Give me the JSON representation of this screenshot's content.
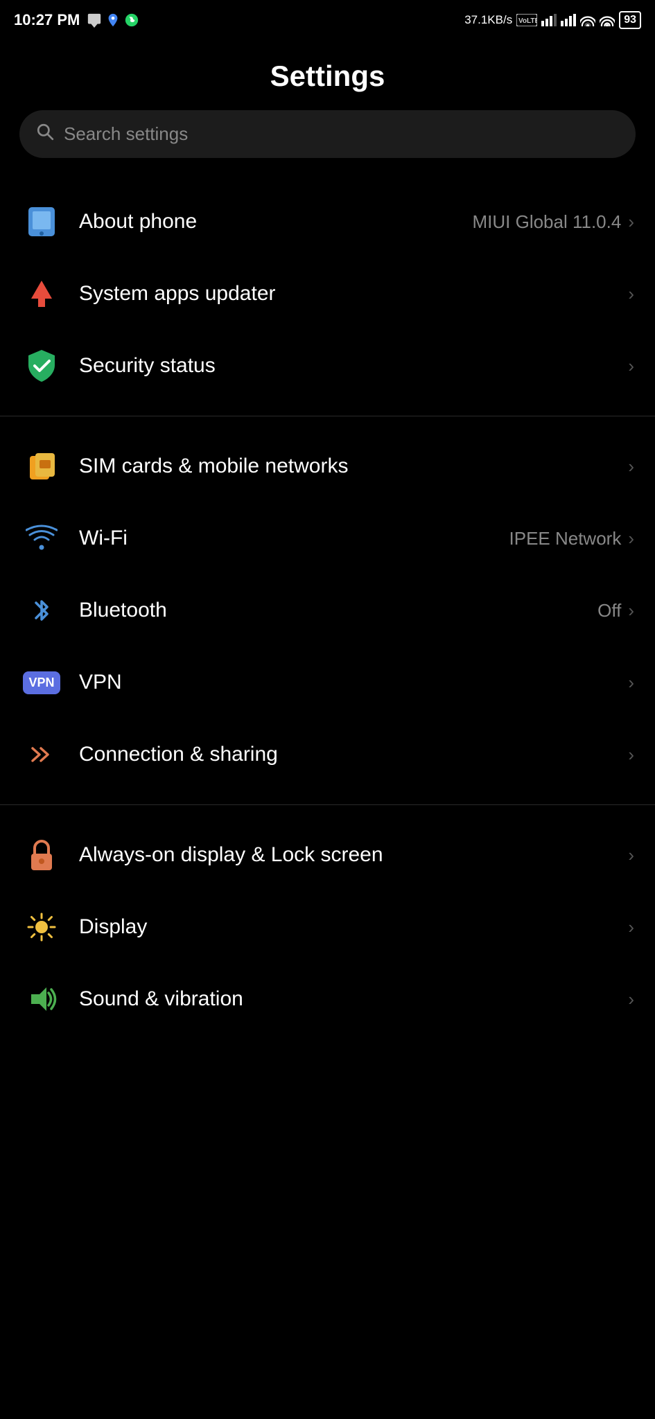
{
  "statusBar": {
    "time": "10:27 PM",
    "speed": "37.1KB/s",
    "battery": "93",
    "icons": [
      "msg",
      "maps",
      "whatsapp",
      "volte",
      "signal1",
      "signal2",
      "wifi1",
      "wifi2"
    ]
  },
  "pageTitle": "Settings",
  "search": {
    "placeholder": "Search settings"
  },
  "sections": [
    {
      "items": [
        {
          "id": "about-phone",
          "label": "About phone",
          "value": "MIUI Global 11.0.4",
          "iconType": "phone"
        },
        {
          "id": "system-apps-updater",
          "label": "System apps updater",
          "value": "",
          "iconType": "arrow-up"
        },
        {
          "id": "security-status",
          "label": "Security status",
          "value": "",
          "iconType": "shield"
        }
      ]
    },
    {
      "items": [
        {
          "id": "sim-cards",
          "label": "SIM cards & mobile networks",
          "value": "",
          "iconType": "sim"
        },
        {
          "id": "wifi",
          "label": "Wi-Fi",
          "value": "IPEE Network",
          "iconType": "wifi"
        },
        {
          "id": "bluetooth",
          "label": "Bluetooth",
          "value": "Off",
          "iconType": "bluetooth"
        },
        {
          "id": "vpn",
          "label": "VPN",
          "value": "",
          "iconType": "vpn"
        },
        {
          "id": "connection-sharing",
          "label": "Connection & sharing",
          "value": "",
          "iconType": "connection"
        }
      ]
    },
    {
      "items": [
        {
          "id": "always-on-display",
          "label": "Always-on display & Lock screen",
          "value": "",
          "iconType": "lock"
        },
        {
          "id": "display",
          "label": "Display",
          "value": "",
          "iconType": "display"
        },
        {
          "id": "sound-vibration",
          "label": "Sound & vibration",
          "value": "",
          "iconType": "sound"
        }
      ]
    }
  ],
  "chevronLabel": "›",
  "labels": {
    "vpn": "VPN"
  }
}
